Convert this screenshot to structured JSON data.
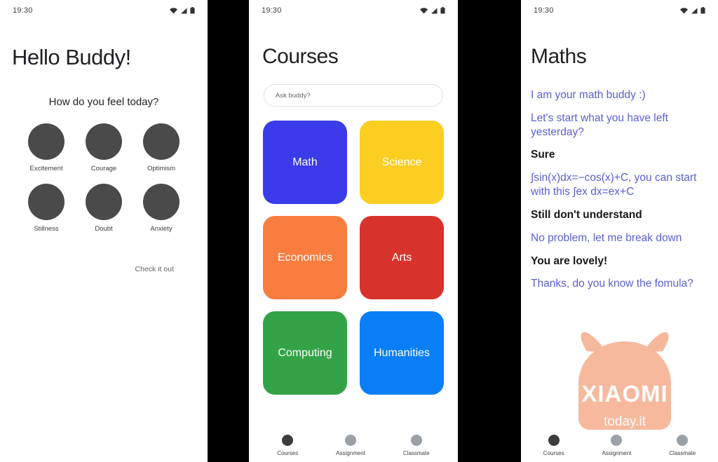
{
  "colors": {
    "buddy_text": "#5a5fd0",
    "user_text": "#17181a",
    "mood_dot": "#4a4a4a",
    "nav_active": "#3c3c3c",
    "nav_inactive": "#9aa0a6",
    "watermark": "#f4a582"
  },
  "status_bar": {
    "time": "19:30",
    "icons": [
      "wifi-icon",
      "cellular-signal-icon",
      "battery-icon"
    ]
  },
  "panel_1": {
    "title": "Hello Buddy!",
    "subtitle": "How do you feel today?",
    "moods": [
      {
        "label": "Excitement"
      },
      {
        "label": "Courage"
      },
      {
        "label": "Optimism"
      },
      {
        "label": "Stillness"
      },
      {
        "label": "Doubt"
      },
      {
        "label": "Anxiety"
      }
    ],
    "cta": "Check it out"
  },
  "panel_2": {
    "title": "Courses",
    "search": {
      "value": "",
      "placeholder": "Ask buddy?"
    },
    "courses": [
      {
        "label": "Math",
        "color": "#3b3bea"
      },
      {
        "label": "Science",
        "color": "#fbce21"
      },
      {
        "label": "Economics",
        "color": "#f97d3f"
      },
      {
        "label": "Arts",
        "color": "#d8322c"
      },
      {
        "label": "Computing",
        "color": "#34a348"
      },
      {
        "label": "Humanities",
        "color": "#0a7ff5"
      }
    ],
    "nav": [
      {
        "label": "Courses",
        "active": true
      },
      {
        "label": "Assignment",
        "active": false
      },
      {
        "label": "Classmate",
        "active": false
      }
    ]
  },
  "panel_3": {
    "title": "Maths",
    "messages": [
      {
        "sender": "buddy",
        "text": "I am your math buddy :)"
      },
      {
        "sender": "buddy",
        "text": "Let's start what you have left yesterday?"
      },
      {
        "sender": "user",
        "text": "Sure"
      },
      {
        "sender": "buddy",
        "text": "∫sin(x)dx=−cos(x)+C, you can start with this ∫ex dx=ex+C"
      },
      {
        "sender": "user",
        "text": "Still don't understand"
      },
      {
        "sender": "buddy",
        "text": "No problem, let me break down"
      },
      {
        "sender": "user",
        "text": "You are lovely!"
      },
      {
        "sender": "buddy",
        "text": "Thanks, do you know the fomula?"
      }
    ],
    "nav": [
      {
        "label": "Courses",
        "active": true
      },
      {
        "label": "Assignment",
        "active": false
      },
      {
        "label": "Classmate",
        "active": false
      }
    ],
    "watermark": {
      "brand": "XIAOMI",
      "site": "today.it"
    }
  }
}
